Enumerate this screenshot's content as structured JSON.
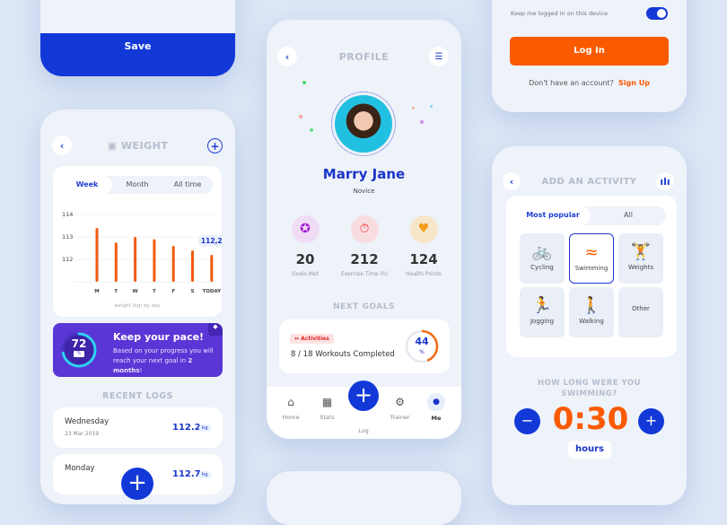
{
  "save_screen": {
    "save_label": "Save"
  },
  "weight_screen": {
    "title": "WEIGHT",
    "back_icon": "chevron-left-icon",
    "add_icon": "plus-circle-icon",
    "title_icon": "scale-icon",
    "tabs": [
      {
        "label": "Week",
        "active": true
      },
      {
        "label": "Month",
        "active": false
      },
      {
        "label": "All time",
        "active": false
      }
    ],
    "chart_data": {
      "type": "bar",
      "categories": [
        "M",
        "T",
        "W",
        "T",
        "F",
        "S",
        "TODAY"
      ],
      "values": [
        113.4,
        112.75,
        113.0,
        112.9,
        112.6,
        112.4,
        112.2
      ],
      "yticks": [
        "114",
        "113",
        "112"
      ],
      "ylim": [
        111,
        114
      ],
      "xlabel": "weight (kg)  by  day",
      "callout": "112,2",
      "color": "#f15a0f"
    },
    "pace": {
      "percent": "72",
      "percent_unit": "%",
      "percent_value": 72,
      "title": "Keep your pace!",
      "text": "Based on your progress you will reach your next goal in ",
      "text_bold": "2 months",
      "text_end": "!"
    },
    "recent_logs_title": "RECENT LOGS",
    "logs": [
      {
        "day": "Wednesday",
        "date": "23 Mar 2019",
        "value": "112.2",
        "unit": "kg"
      },
      {
        "day": "Monday",
        "date": "",
        "value": "112.7",
        "unit": "kg"
      }
    ]
  },
  "profile_screen": {
    "title": "PROFILE",
    "name": "Marry Jane",
    "level": "Novice",
    "stats": [
      {
        "value": "20",
        "label": "Goals Met",
        "icon": "award-icon",
        "bg": "#f1dcf6",
        "color": "#a020d0"
      },
      {
        "value": "212",
        "label": "Exercise Time (h)",
        "icon": "stopwatch-icon",
        "bg": "#f8dde0",
        "color": "#ee3030"
      },
      {
        "value": "124",
        "label": "Health Points",
        "icon": "heart-plus-icon",
        "bg": "#f7e7c8",
        "color": "#f39a1a"
      }
    ],
    "next_goals_title": "NEXT GOALS",
    "goal": {
      "tag": "Activities",
      "text": "8 / 18 Workouts Completed",
      "percent": "44",
      "unit": "%",
      "percent_value": 44
    },
    "nav": [
      {
        "label": "Home",
        "icon": "home-icon"
      },
      {
        "label": "Stats",
        "icon": "stats-icon"
      },
      {
        "label": "Log",
        "icon": "plus-icon"
      },
      {
        "label": "Trainer",
        "icon": "trainer-icon"
      },
      {
        "label": "Me",
        "icon": "user-icon",
        "active": true
      }
    ]
  },
  "login_screen": {
    "keep_logged": "Keep me logged in on this device",
    "toggle_on": true,
    "login_label": "Log In",
    "no_account": "Don't have an account?",
    "signup": "Sign Up"
  },
  "activity_screen": {
    "title": "ADD AN ACTIVITY",
    "tabs": [
      {
        "label": "Most popular",
        "active": true
      },
      {
        "label": "All",
        "active": false
      }
    ],
    "activities": [
      {
        "label": "Cycling",
        "icon": "cycling-icon"
      },
      {
        "label": "Swimming",
        "icon": "swimming-icon",
        "selected": true
      },
      {
        "label": "Weights",
        "icon": "weights-icon"
      },
      {
        "label": "Jogging",
        "icon": "jogging-icon"
      },
      {
        "label": "Walking",
        "icon": "walking-icon"
      },
      {
        "label": "Other",
        "icon": ""
      }
    ],
    "question": "HOW LONG WERE YOU SWIMMING?",
    "duration": "0:30",
    "unit": "hours"
  },
  "colors": {
    "primary": "#1239d8",
    "accent": "#fa5a00",
    "purple": "#5a36d6",
    "background": "#dde7f6"
  }
}
